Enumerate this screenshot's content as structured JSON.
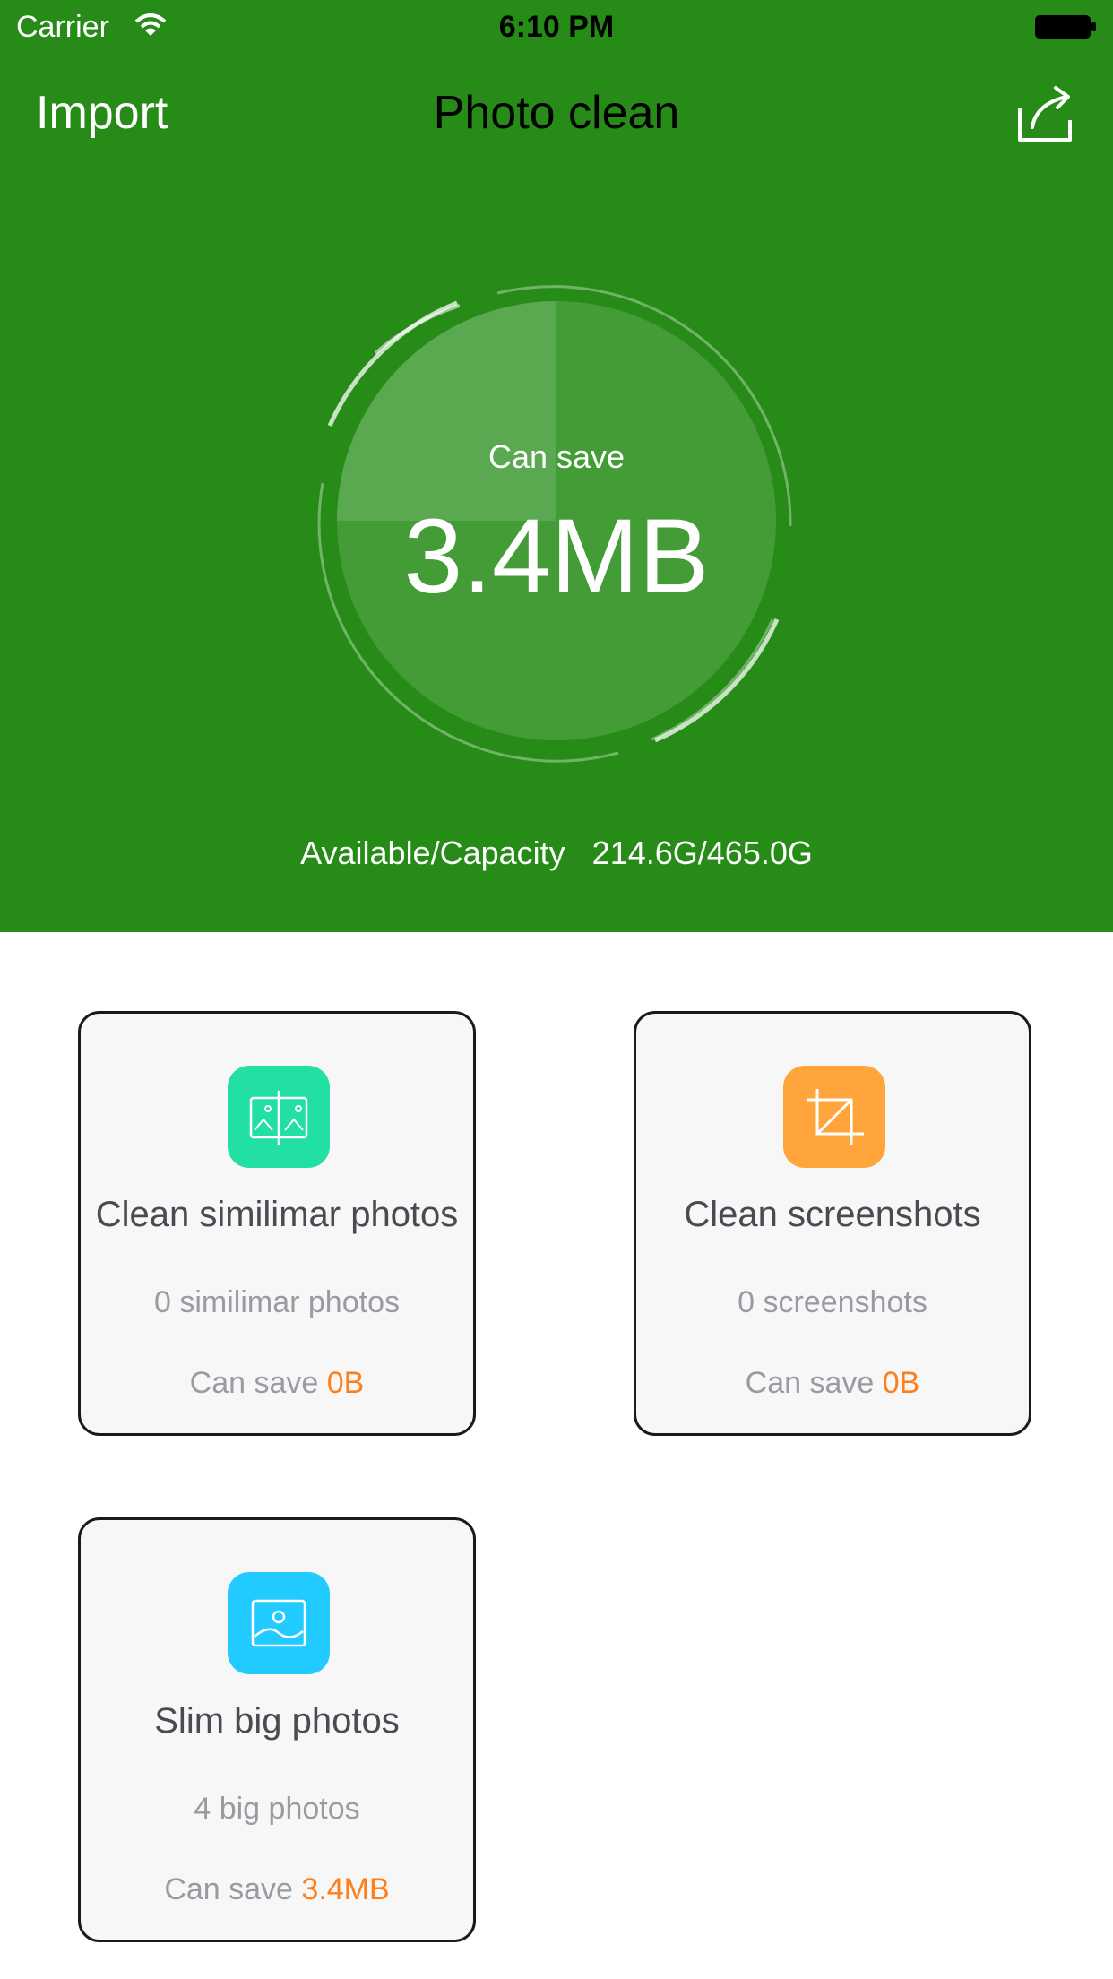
{
  "status_bar": {
    "carrier": "Carrier",
    "time": "6:10 PM"
  },
  "nav": {
    "import_label": "Import",
    "title": "Photo clean",
    "share_icon": "share-icon"
  },
  "gauge": {
    "label": "Can save",
    "value": "3.4MB",
    "fill_fraction": 0.25
  },
  "storage": {
    "label": "Available/Capacity",
    "value": "214.6G/465.0G"
  },
  "cards": [
    {
      "icon": "compare-photos-icon",
      "icon_color": "#22e0a3",
      "title": "Clean similimar photos",
      "count": "0 similimar photos",
      "save_prefix": "Can save",
      "save_value": "0B"
    },
    {
      "icon": "crop-icon",
      "icon_color": "#ffa53c",
      "title": "Clean screenshots",
      "count": "0 screenshots",
      "save_prefix": "Can save",
      "save_value": "0B"
    },
    {
      "icon": "image-icon",
      "icon_color": "#21cbff",
      "title": "Slim big photos",
      "count": "4 big photos",
      "save_prefix": "Can save",
      "save_value": "3.4MB"
    }
  ],
  "colors": {
    "header_bg": "#268c17",
    "accent_orange": "#ff7e1c"
  }
}
